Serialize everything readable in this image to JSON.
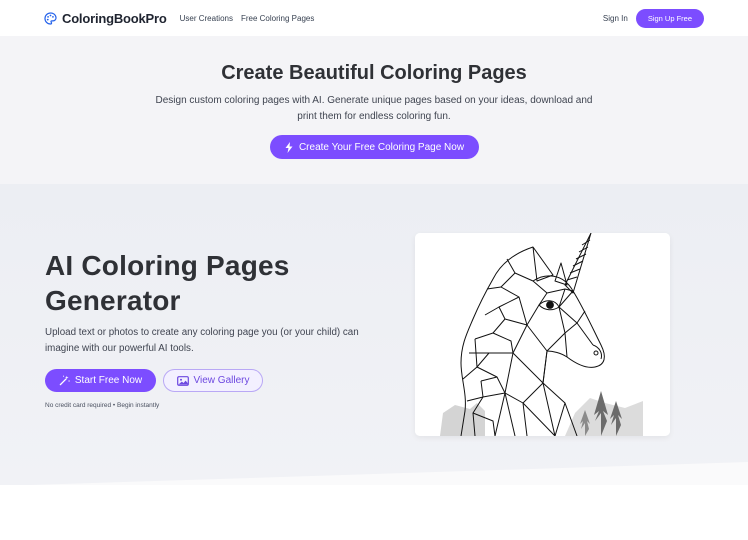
{
  "nav": {
    "brand": "ColoringBookPro",
    "links": [
      "User Creations",
      "Free Coloring Pages"
    ],
    "sign_in": "Sign In",
    "sign_up": "Sign Up Free"
  },
  "hero1": {
    "title": "Create Beautiful Coloring Pages",
    "subtitle": "Design custom coloring pages with AI. Generate unique pages based on your ideas, download and print them for endless coloring fun.",
    "cta": "Create Your Free Coloring Page Now"
  },
  "hero2": {
    "title": "AI Coloring Pages Generator",
    "subtitle": "Upload text or photos to create any coloring page you (or your child) can imagine with our powerful AI tools.",
    "start_button": "Start Free Now",
    "gallery_button": "View Gallery",
    "note": "No credit card required • Begin instantly"
  },
  "colors": {
    "accent": "#7c4dff",
    "hero1_bg": "#f4f4f7",
    "hero2_bg": "#eceef3"
  },
  "icons": {
    "brand": "palette-icon",
    "cta": "lightning-icon",
    "start": "magic-wand-icon",
    "gallery": "image-icon"
  }
}
